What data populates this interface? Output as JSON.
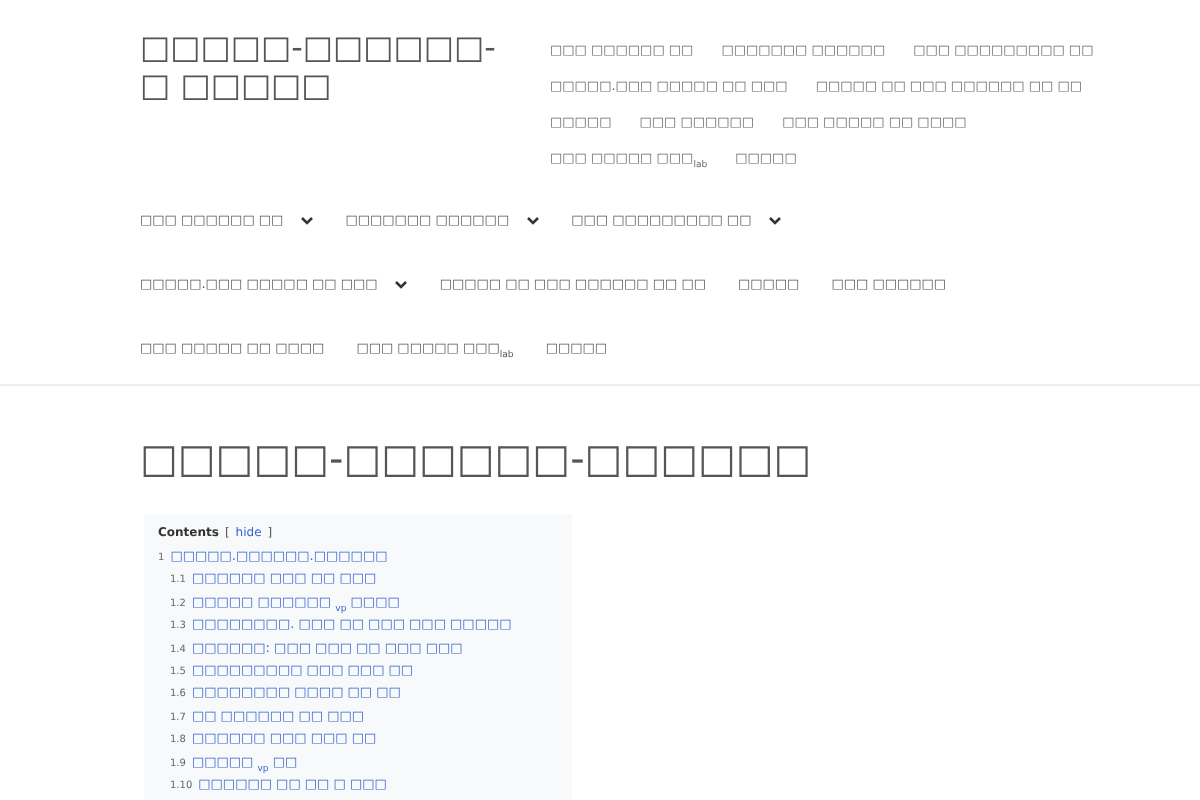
{
  "site_title": "□□□□□-□□□□□□-□ □□□□□",
  "top_links": [
    "□□□ □□□□□□ □□",
    "□□□□□□□ □□□□□□",
    "□□□ □□□□□□□□□ □□",
    "□□□□□.□□□ □□□□□ □□ □□□",
    "□□□□□ □□ □□□ □□□□□□ □□ □□",
    "□□□□□",
    "□□□ □□□□□□",
    "□□□ □□□□□ □□ □□□□",
    "□□□ □□□□□ □□□$_{lab}$",
    "□□□□□"
  ],
  "main_menu": [
    {
      "label": "□□□ □□□□□□ □□",
      "has_submenu": true
    },
    {
      "label": "□□□□□□□ □□□□□□",
      "has_submenu": true
    },
    {
      "label": "□□□ □□□□□□□□□ □□",
      "has_submenu": true
    },
    {
      "label": "□□□□□.□□□ □□□□□ □□ □□□",
      "has_submenu": true
    },
    {
      "label": "□□□□□ □□ □□□ □□□□□□ □□ □□",
      "has_submenu": false
    },
    {
      "label": "□□□□□",
      "has_submenu": false
    },
    {
      "label": "□□□ □□□□□□",
      "has_submenu": false
    },
    {
      "label": "□□□ □□□□□ □□ □□□□",
      "has_submenu": false
    },
    {
      "label": "□□□ □□□□□ □□□$_{lab}$",
      "has_submenu": false
    },
    {
      "label": "□□□□□",
      "has_submenu": false
    }
  ],
  "page_title": "□□□□□-□□□□□□-□□□□□□",
  "toc": {
    "title": "Contents",
    "toggle_open": "[",
    "toggle": "hide",
    "toggle_close": "]",
    "items": [
      {
        "number": "1",
        "text": "□□□□□.□□□□□□.□□□□□□",
        "children": [
          {
            "number": "1.1",
            "text": "□□□□□□ □□□ □□ □□□"
          },
          {
            "number": "1.2",
            "text": "□□□□□ □□□□□□ $_{vp}$ □□□□"
          },
          {
            "number": "1.3",
            "text": "□□□□□□□□. □□□ □□ □□□ □□□ □□□□□"
          },
          {
            "number": "1.4",
            "text": "□□□□□□: □□□ □□□ □□ □□□ □□□"
          },
          {
            "number": "1.5",
            "text": "□□□□□□□□□ □□□ □□□ □□"
          },
          {
            "number": "1.6",
            "text": "□□□□□□□□ □□□□ □□ □□"
          },
          {
            "number": "1.7",
            "text": "□□ □□□□□□ □□ □□□"
          },
          {
            "number": "1.8",
            "text": "□□□□□□ □□□ □□□ □□"
          },
          {
            "number": "1.9",
            "text": "□□□□□ $_{vp}$ □□"
          },
          {
            "number": "1.10",
            "text": "□□□□□□ □□ □□ □ □□□"
          }
        ]
      }
    ]
  }
}
